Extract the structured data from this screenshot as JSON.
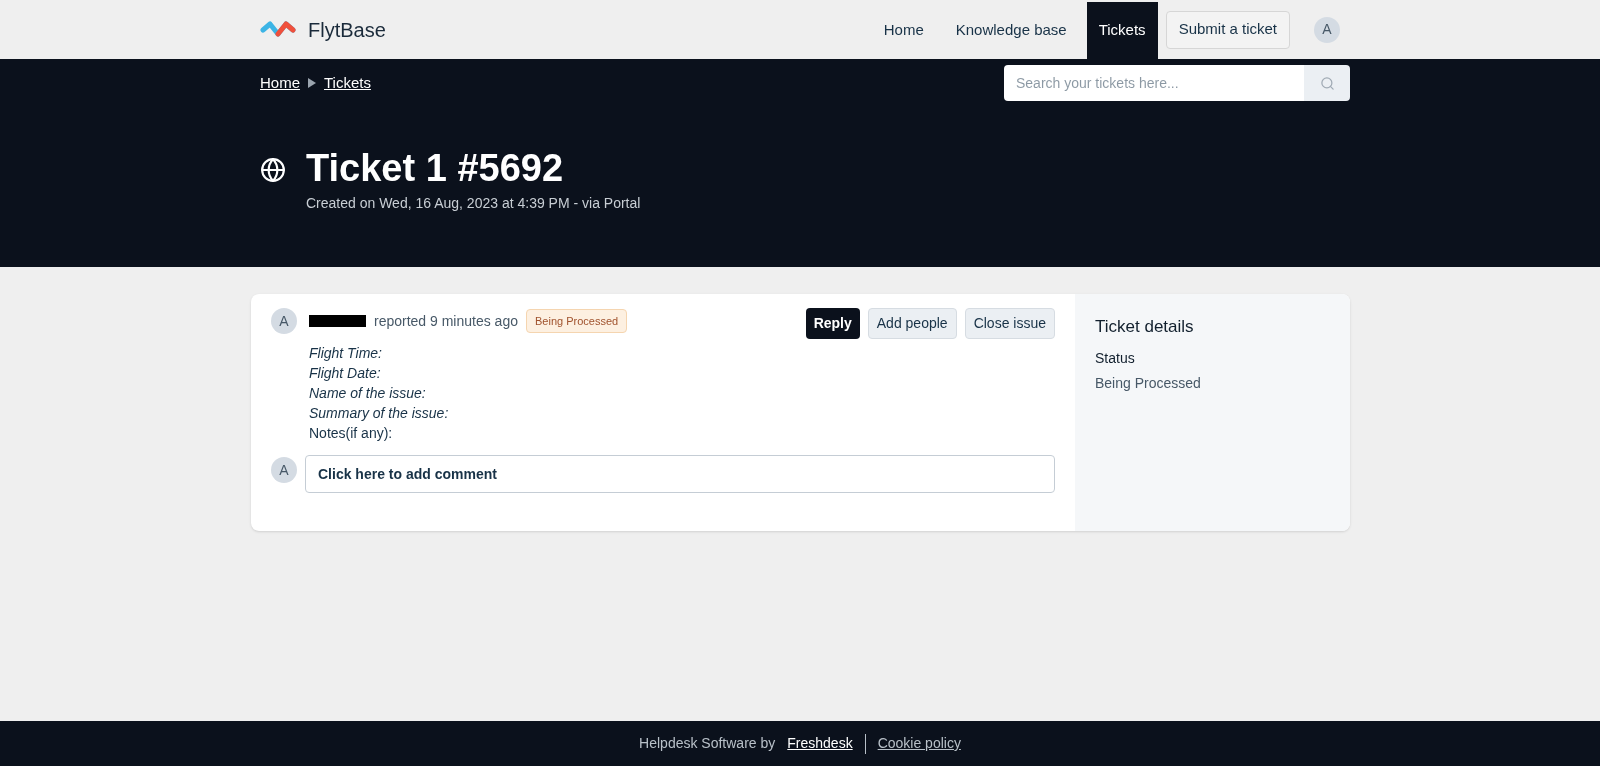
{
  "brand": {
    "name": "FlytBase"
  },
  "nav": [
    {
      "label": "Home",
      "selected": false,
      "kind": "link"
    },
    {
      "label": "Knowledge base",
      "selected": false,
      "kind": "link"
    },
    {
      "label": "Tickets",
      "selected": true,
      "kind": "link"
    },
    {
      "label": "Submit a ticket",
      "selected": false,
      "kind": "button"
    }
  ],
  "user_avatar": "A",
  "breadcrumbs": [
    "Home",
    "Tickets"
  ],
  "search": {
    "placeholder": "Search your tickets here..."
  },
  "ticket": {
    "title": "Ticket 1 #5692",
    "subtitle": "Created on Wed, 16 Aug, 2023 at 4:39 PM - via Portal"
  },
  "post": {
    "avatar": "A",
    "reported": "reported 9 minutes ago",
    "status_badge": "Being Processed",
    "actions": [
      {
        "label": "Reply",
        "kind": "primary"
      },
      {
        "label": "Add people",
        "kind": "secondary"
      },
      {
        "label": "Close issue",
        "kind": "secondary"
      }
    ],
    "body": [
      {
        "text": "Flight Time:",
        "italic": true
      },
      {
        "text": "Flight Date:",
        "italic": true
      },
      {
        "text": "Name of the issue:",
        "italic": true
      },
      {
        "text": "Summary of the issue:",
        "italic": true
      },
      {
        "text": "Notes(if any):",
        "italic": false
      }
    ]
  },
  "comment": {
    "avatar": "A",
    "placeholder": "Click here to add comment"
  },
  "details": {
    "title": "Ticket details",
    "fields": [
      {
        "label": "Status",
        "value": "Being Processed"
      }
    ]
  },
  "footer": {
    "text": "Helpdesk Software by",
    "links": [
      "Freshdesk",
      "Cookie policy"
    ]
  }
}
